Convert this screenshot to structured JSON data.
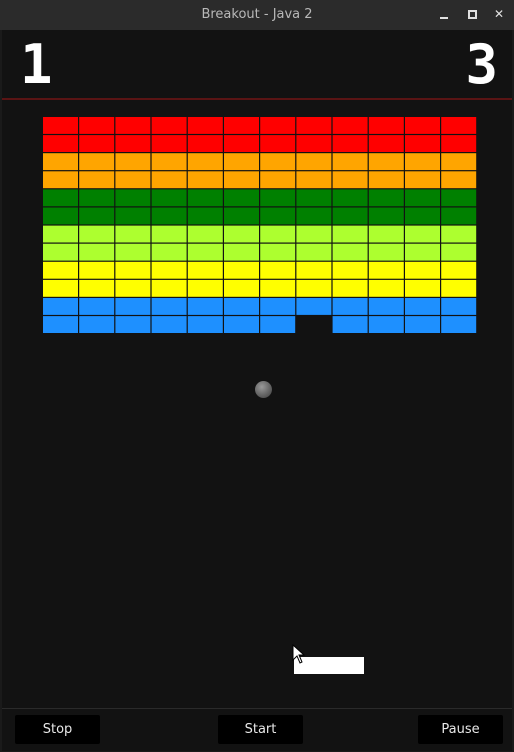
{
  "window": {
    "title": "Breakout - Java 2",
    "controls": [
      "minimize-icon",
      "maximize-icon",
      "close-icon"
    ]
  },
  "scoreboard": {
    "left": "1",
    "right": "3"
  },
  "game": {
    "brick_columns": 12,
    "rows": [
      {
        "color": "#ff0000",
        "bricks": [
          1,
          1,
          1,
          1,
          1,
          1,
          1,
          1,
          1,
          1,
          1,
          1
        ]
      },
      {
        "color": "#ff0000",
        "bricks": [
          1,
          1,
          1,
          1,
          1,
          1,
          1,
          1,
          1,
          1,
          1,
          1
        ]
      },
      {
        "color": "#ffa500",
        "bricks": [
          1,
          1,
          1,
          1,
          1,
          1,
          1,
          1,
          1,
          1,
          1,
          1
        ]
      },
      {
        "color": "#ffa500",
        "bricks": [
          1,
          1,
          1,
          1,
          1,
          1,
          1,
          1,
          1,
          1,
          1,
          1
        ]
      },
      {
        "color": "#008000",
        "bricks": [
          1,
          1,
          1,
          1,
          1,
          1,
          1,
          1,
          1,
          1,
          1,
          1
        ]
      },
      {
        "color": "#008000",
        "bricks": [
          1,
          1,
          1,
          1,
          1,
          1,
          1,
          1,
          1,
          1,
          1,
          1
        ]
      },
      {
        "color": "#adff2f",
        "bricks": [
          1,
          1,
          1,
          1,
          1,
          1,
          1,
          1,
          1,
          1,
          1,
          1
        ]
      },
      {
        "color": "#adff2f",
        "bricks": [
          1,
          1,
          1,
          1,
          1,
          1,
          1,
          1,
          1,
          1,
          1,
          1
        ]
      },
      {
        "color": "#ffff00",
        "bricks": [
          1,
          1,
          1,
          1,
          1,
          1,
          1,
          1,
          1,
          1,
          1,
          1
        ]
      },
      {
        "color": "#ffff00",
        "bricks": [
          1,
          1,
          1,
          1,
          1,
          1,
          1,
          1,
          1,
          1,
          1,
          1
        ]
      },
      {
        "color": "#1e90ff",
        "bricks": [
          1,
          1,
          1,
          1,
          1,
          1,
          1,
          1,
          1,
          1,
          1,
          1
        ]
      },
      {
        "color": "#1e90ff",
        "bricks": [
          1,
          1,
          1,
          1,
          1,
          1,
          1,
          0,
          1,
          1,
          1,
          1
        ]
      }
    ],
    "ball_color": "#6e6e6e",
    "paddle_color": "#ffffff",
    "divider_color": "#5a1414"
  },
  "controls": {
    "stop_label": "Stop",
    "start_label": "Start",
    "pause_label": "Pause"
  }
}
